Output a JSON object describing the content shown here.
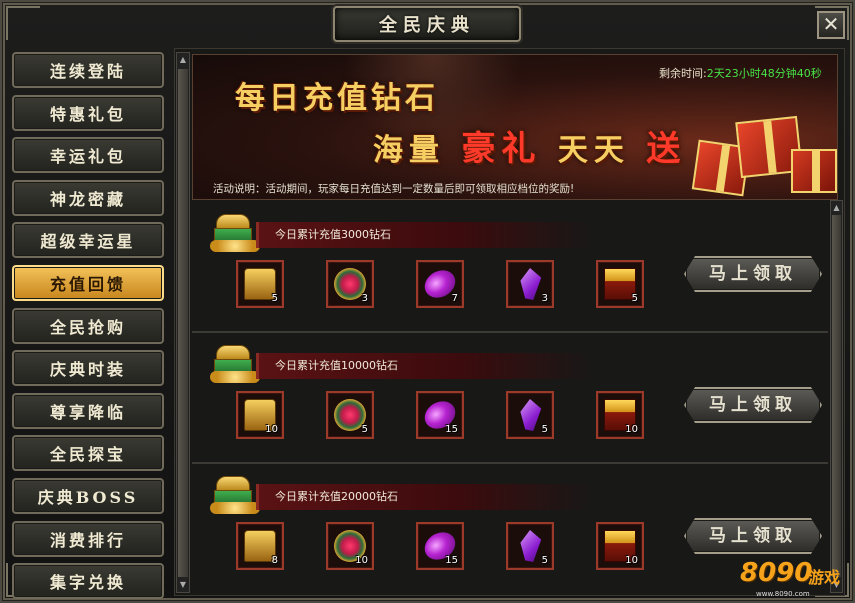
{
  "window": {
    "title": "全民庆典",
    "close_label": "✕"
  },
  "sidebar": {
    "items": [
      {
        "label": "连续登陆",
        "active": false
      },
      {
        "label": "特惠礼包",
        "active": false
      },
      {
        "label": "幸运礼包",
        "active": false
      },
      {
        "label": "神龙密藏",
        "active": false
      },
      {
        "label": "超级幸运星",
        "active": false
      },
      {
        "label": "充值回馈",
        "active": true
      },
      {
        "label": "全民抢购",
        "active": false
      },
      {
        "label": "庆典时装",
        "active": false
      },
      {
        "label": "尊享降临",
        "active": false
      },
      {
        "label": "全民探宝",
        "active": false
      },
      {
        "label": "庆典BOSS",
        "active": false
      },
      {
        "label": "消费排行",
        "active": false
      },
      {
        "label": "集字兑换",
        "active": false
      }
    ]
  },
  "banner": {
    "line1": "每日充值钻石",
    "line2_a": "海量",
    "line2_hl": "豪礼",
    "line2_b": "天天",
    "line2_c": "送",
    "remain_label": "剩余时间:",
    "remain_value": "2天23小时48分钟40秒",
    "desc": "活动说明：活动期间，玩家每日充值达到一定数量后即可领取相应档位的奖励!"
  },
  "tiers": [
    {
      "title": "今日累计充值3000钻石",
      "items": [
        {
          "icon": "gold-chest-icon",
          "count": "5"
        },
        {
          "icon": "ruby-amulet-icon",
          "count": "3"
        },
        {
          "icon": "purple-orb-icon",
          "count": "7"
        },
        {
          "icon": "purple-crystal-icon",
          "count": "3"
        },
        {
          "icon": "treasure-chest-icon",
          "count": "5"
        }
      ],
      "button": "马上领取"
    },
    {
      "title": "今日累计充值10000钻石",
      "items": [
        {
          "icon": "gold-chest-icon",
          "count": "10"
        },
        {
          "icon": "ruby-amulet-icon",
          "count": "5"
        },
        {
          "icon": "purple-orb-icon",
          "count": "15"
        },
        {
          "icon": "purple-crystal-icon",
          "count": "5"
        },
        {
          "icon": "treasure-chest-icon",
          "count": "10"
        }
      ],
      "button": "马上领取"
    },
    {
      "title": "今日累计充值20000钻石",
      "items": [
        {
          "icon": "gold-chest-icon",
          "count": "8"
        },
        {
          "icon": "ruby-amulet-icon",
          "count": "10"
        },
        {
          "icon": "purple-orb-icon",
          "count": "15"
        },
        {
          "icon": "purple-crystal-icon",
          "count": "5"
        },
        {
          "icon": "treasure-chest-icon",
          "count": "10"
        }
      ],
      "button": "马上领取"
    }
  ],
  "watermark": {
    "num": "8090",
    "text": "游戏",
    "url": "www.8090.com"
  },
  "colors": {
    "active_tab": "#f4c25a",
    "remain_value": "#47e347",
    "highlight": "#ff3a2a"
  }
}
